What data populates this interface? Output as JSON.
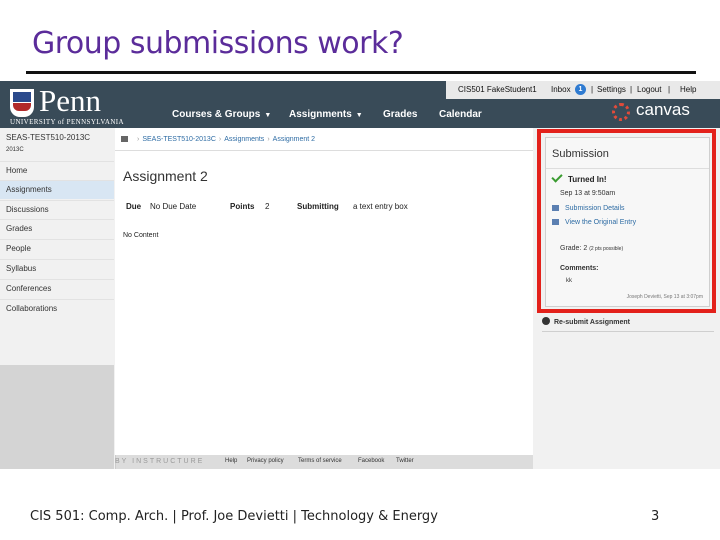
{
  "slide": {
    "title": "Group submissions work?",
    "footer": "CIS 501: Comp. Arch.  |  Prof. Joe Devietti  |  Technology & Energy",
    "page_number": "3"
  },
  "canvas": {
    "logo_word": "Penn",
    "logo_sub": "UNIVERSITY of PENNSYLVANIA",
    "brand": "canvas",
    "nav": [
      "Courses & Groups",
      "Assignments",
      "Grades",
      "Calendar"
    ],
    "user": {
      "name": "CIS501 FakeStudent1",
      "inbox": "Inbox",
      "inbox_count": "1",
      "settings": "Settings",
      "logout": "Logout",
      "help": "Help"
    },
    "course": {
      "title": "SEAS-TEST510-2013C",
      "term": "2013C"
    },
    "breadcrumb": [
      "SEAS-TEST510-2013C",
      "Assignments",
      "Assignment 2"
    ],
    "sidebar_links": [
      "Home",
      "Assignments",
      "Discussions",
      "Grades",
      "People",
      "Syllabus",
      "Conferences",
      "Collaborations"
    ],
    "active_link": "Assignments",
    "assignment": {
      "title": "Assignment 2",
      "due_label": "Due",
      "due_value": "No Due Date",
      "points_label": "Points",
      "points_value": "2",
      "submitting_label": "Submitting",
      "submitting_value": "a text entry box",
      "body": "No Content"
    },
    "submission": {
      "heading": "Submission",
      "status": "Turned In!",
      "date": "Sep 13 at 9:50am",
      "details_link": "Submission Details",
      "original_link": "View the Original Entry",
      "grade": "Grade: 2",
      "grade_note": "(2 pts possible)",
      "comments_label": "Comments:",
      "comment": "kk",
      "comment_meta": "Joseph Devietti, Sep 13 at 3:07pm"
    },
    "resubmit": "Re-submit Assignment",
    "footer": {
      "brand": "BY INSTRUCTURE",
      "links": [
        "Help",
        "Privacy policy",
        "Terms of service",
        "Facebook",
        "Twitter"
      ]
    },
    "colors": {
      "header": "#394b58",
      "highlight": "#e3211b",
      "link": "#2e6ca4",
      "title": "#5b2c9a"
    }
  }
}
